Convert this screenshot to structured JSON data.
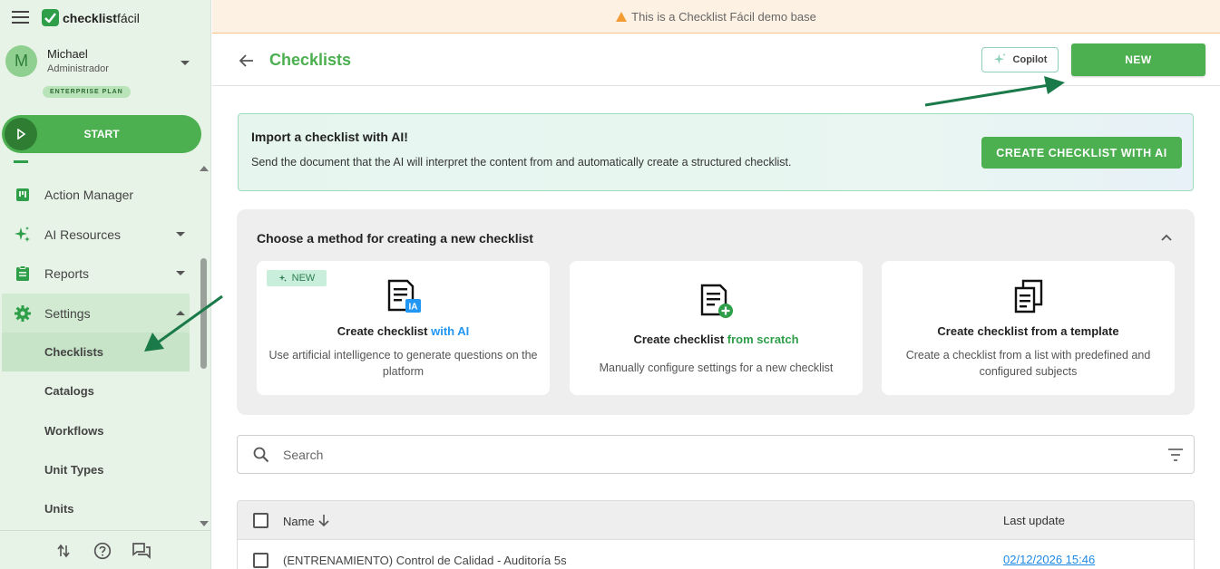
{
  "app": {
    "logo_text_bold": "checklist",
    "logo_text_light": "fácil"
  },
  "user": {
    "initial": "M",
    "name": "Michael",
    "role": "Administrador",
    "plan": "ENTERPRISE PLAN"
  },
  "sidebar": {
    "start_label": "START",
    "items": [
      {
        "label": "Action Manager",
        "icon": "action-manager-icon"
      },
      {
        "label": "AI Resources",
        "icon": "sparkle-icon"
      },
      {
        "label": "Reports",
        "icon": "clipboard-icon"
      },
      {
        "label": "Settings",
        "icon": "gear-icon"
      }
    ],
    "sub_items": [
      "Checklists",
      "Catalogs",
      "Workflows",
      "Unit Types",
      "Units"
    ],
    "active_sub": "Checklists"
  },
  "banner": {
    "text": "This is a Checklist Fácil demo base"
  },
  "header": {
    "title": "Checklists",
    "copilot_label": "Copilot",
    "new_label": "NEW"
  },
  "ai_import": {
    "title": "Import a checklist with AI!",
    "description": "Send the document that the AI will interpret the content from and automatically create a structured checklist.",
    "button": "CREATE CHECKLIST WITH AI"
  },
  "method": {
    "title": "Choose a method for creating a new checklist",
    "options": [
      {
        "tag": "NEW",
        "title_prefix": "Create checklist ",
        "title_highlight": "with AI",
        "description": "Use artificial intelligence to generate questions on the platform"
      },
      {
        "title_prefix": "Create checklist ",
        "title_highlight": "from scratch",
        "description": "Manually configure settings for a new checklist"
      },
      {
        "title_prefix": "Create checklist from a template",
        "title_highlight": "",
        "description": "Create a checklist from a list with predefined and configured subjects"
      }
    ]
  },
  "search": {
    "placeholder": "Search"
  },
  "table": {
    "columns": [
      "Name",
      "Last update"
    ],
    "rows": [
      {
        "name": "(ENTRENAMIENTO) Control de Calidad - Auditoría 5s",
        "last_update": "02/12/2026 15:46"
      }
    ]
  },
  "colors": {
    "brand_green": "#4caf50",
    "annotation_arrow": "#1b7a4a",
    "link_blue": "#1e88e5"
  }
}
